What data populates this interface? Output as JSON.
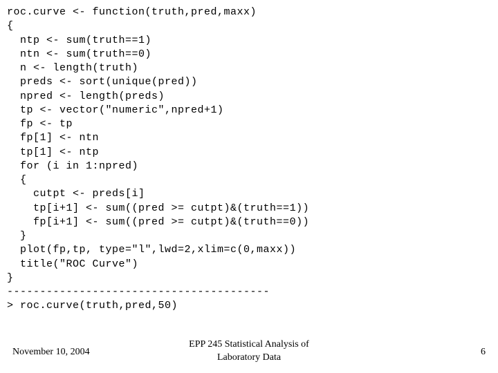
{
  "code": {
    "lines": [
      "roc.curve <- function(truth,pred,maxx)",
      "{",
      "  ntp <- sum(truth==1)",
      "  ntn <- sum(truth==0)",
      "  n <- length(truth)",
      "  preds <- sort(unique(pred))",
      "  npred <- length(preds)",
      "  tp <- vector(\"numeric\",npred+1)",
      "  fp <- tp",
      "  fp[1] <- ntn",
      "  tp[1] <- ntp",
      "  for (i in 1:npred)",
      "  {",
      "    cutpt <- preds[i]",
      "    tp[i+1] <- sum((pred >= cutpt)&(truth==1))",
      "    fp[i+1] <- sum((pred >= cutpt)&(truth==0))",
      "  }",
      "  plot(fp,tp, type=\"l\",lwd=2,xlim=c(0,maxx))",
      "  title(\"ROC Curve\")",
      "}",
      "----------------------------------------",
      "> roc.curve(truth,pred,50)"
    ]
  },
  "footer": {
    "date": "November 10, 2004",
    "title_line1": "EPP 245 Statistical Analysis of",
    "title_line2": "Laboratory Data",
    "page": "6"
  }
}
